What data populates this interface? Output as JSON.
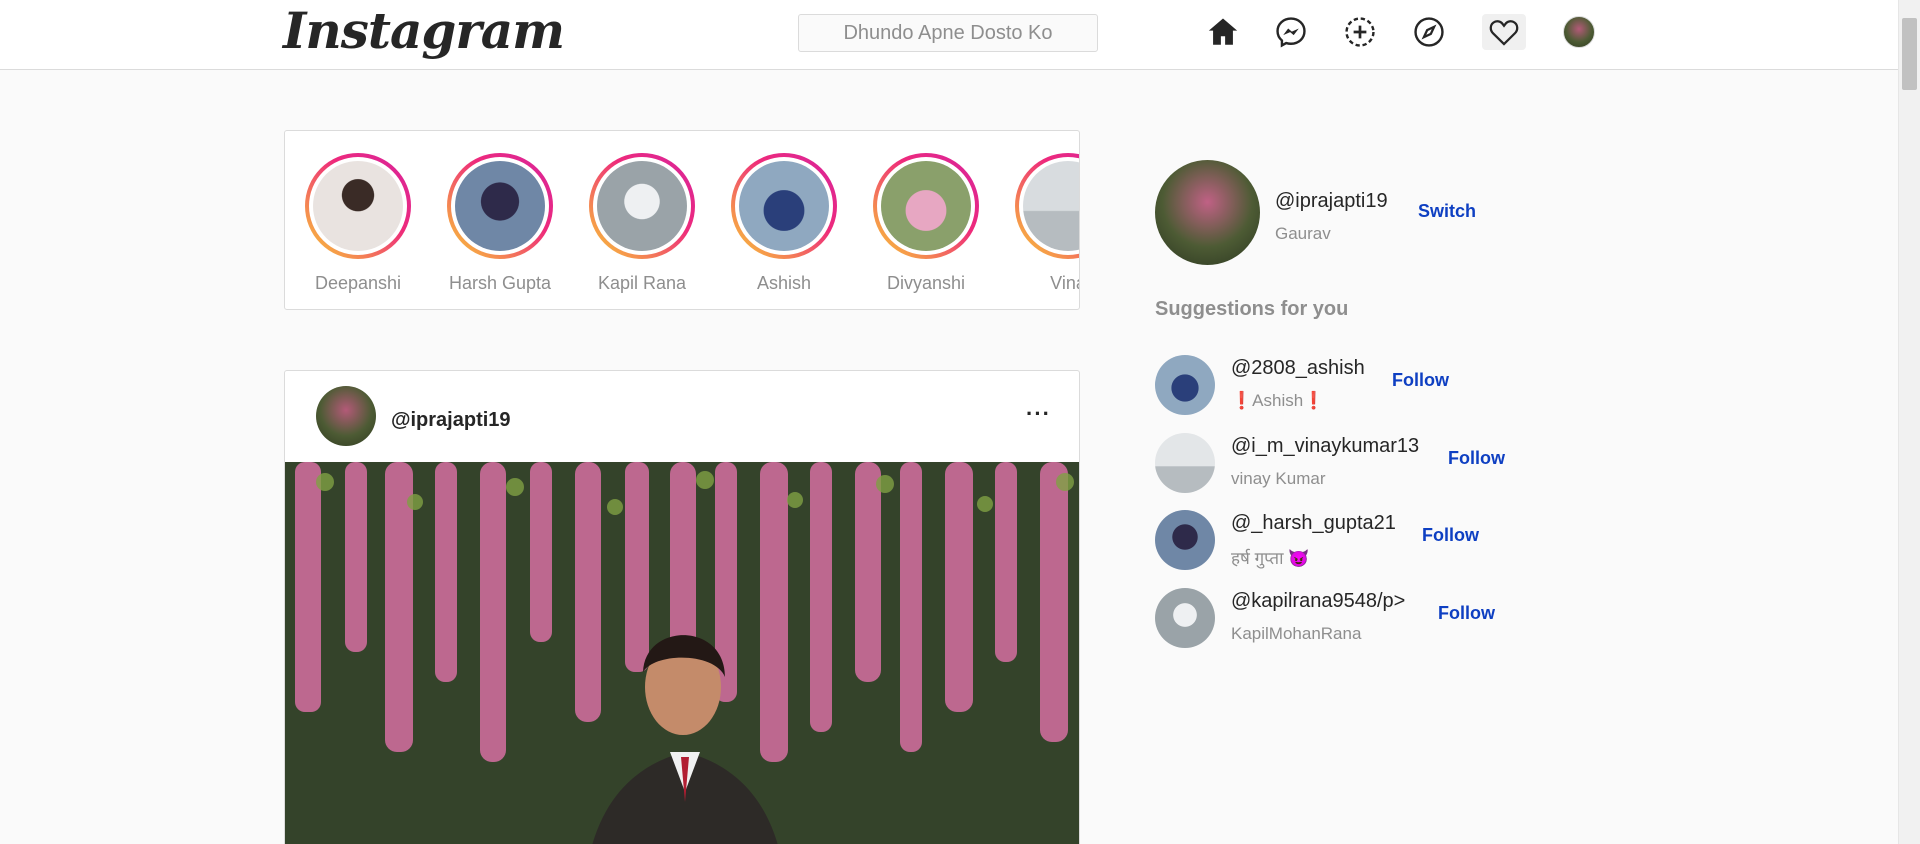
{
  "nav": {
    "logo": "Instagram",
    "search_placeholder": "Dhundo Apne Dosto Ko",
    "icons": [
      "home-icon",
      "messenger-icon",
      "new-post-icon",
      "explore-icon",
      "heart-icon"
    ]
  },
  "stories": [
    {
      "name": "Deepanshi",
      "tone": "#e9e3e0"
    },
    {
      "name": "Harsh Gupta",
      "tone": "#6f87a6"
    },
    {
      "name": "Kapil Rana",
      "tone": "#9aa3a8"
    },
    {
      "name": "Ashish",
      "tone": "#5d7fa8"
    },
    {
      "name": "Divyanshi",
      "tone": "#8aa06b"
    },
    {
      "name": "Vina",
      "tone": "#cfd3d6"
    }
  ],
  "post": {
    "username": "@iprajapti19",
    "more_label": "···"
  },
  "profile": {
    "handle": "@iprajapti19",
    "name": "Gaurav",
    "switch_label": "Switch"
  },
  "suggestions": {
    "title": "Suggestions for you",
    "items": [
      {
        "handle": "@2808_ashish",
        "name": "❗Ashish❗",
        "follow": "Follow",
        "tone": "#5d7fa8"
      },
      {
        "handle": "@i_m_vinaykumar13",
        "name": "vinay Kumar",
        "follow": "Follow",
        "tone": "#cfd3d6"
      },
      {
        "handle": "@_harsh_gupta21",
        "name": "हर्ष गुप्ता 😈",
        "follow": "Follow",
        "tone": "#6f87a6"
      },
      {
        "handle": "@kapilrana9548/p>",
        "name": "KapilMohanRana",
        "follow": "Follow",
        "tone": "#9aa3a8"
      }
    ]
  },
  "colors": {
    "link_blue": "#0e3fc2",
    "story_ring_start": "#f9ce34",
    "story_ring_end": "#ee2a7b"
  }
}
